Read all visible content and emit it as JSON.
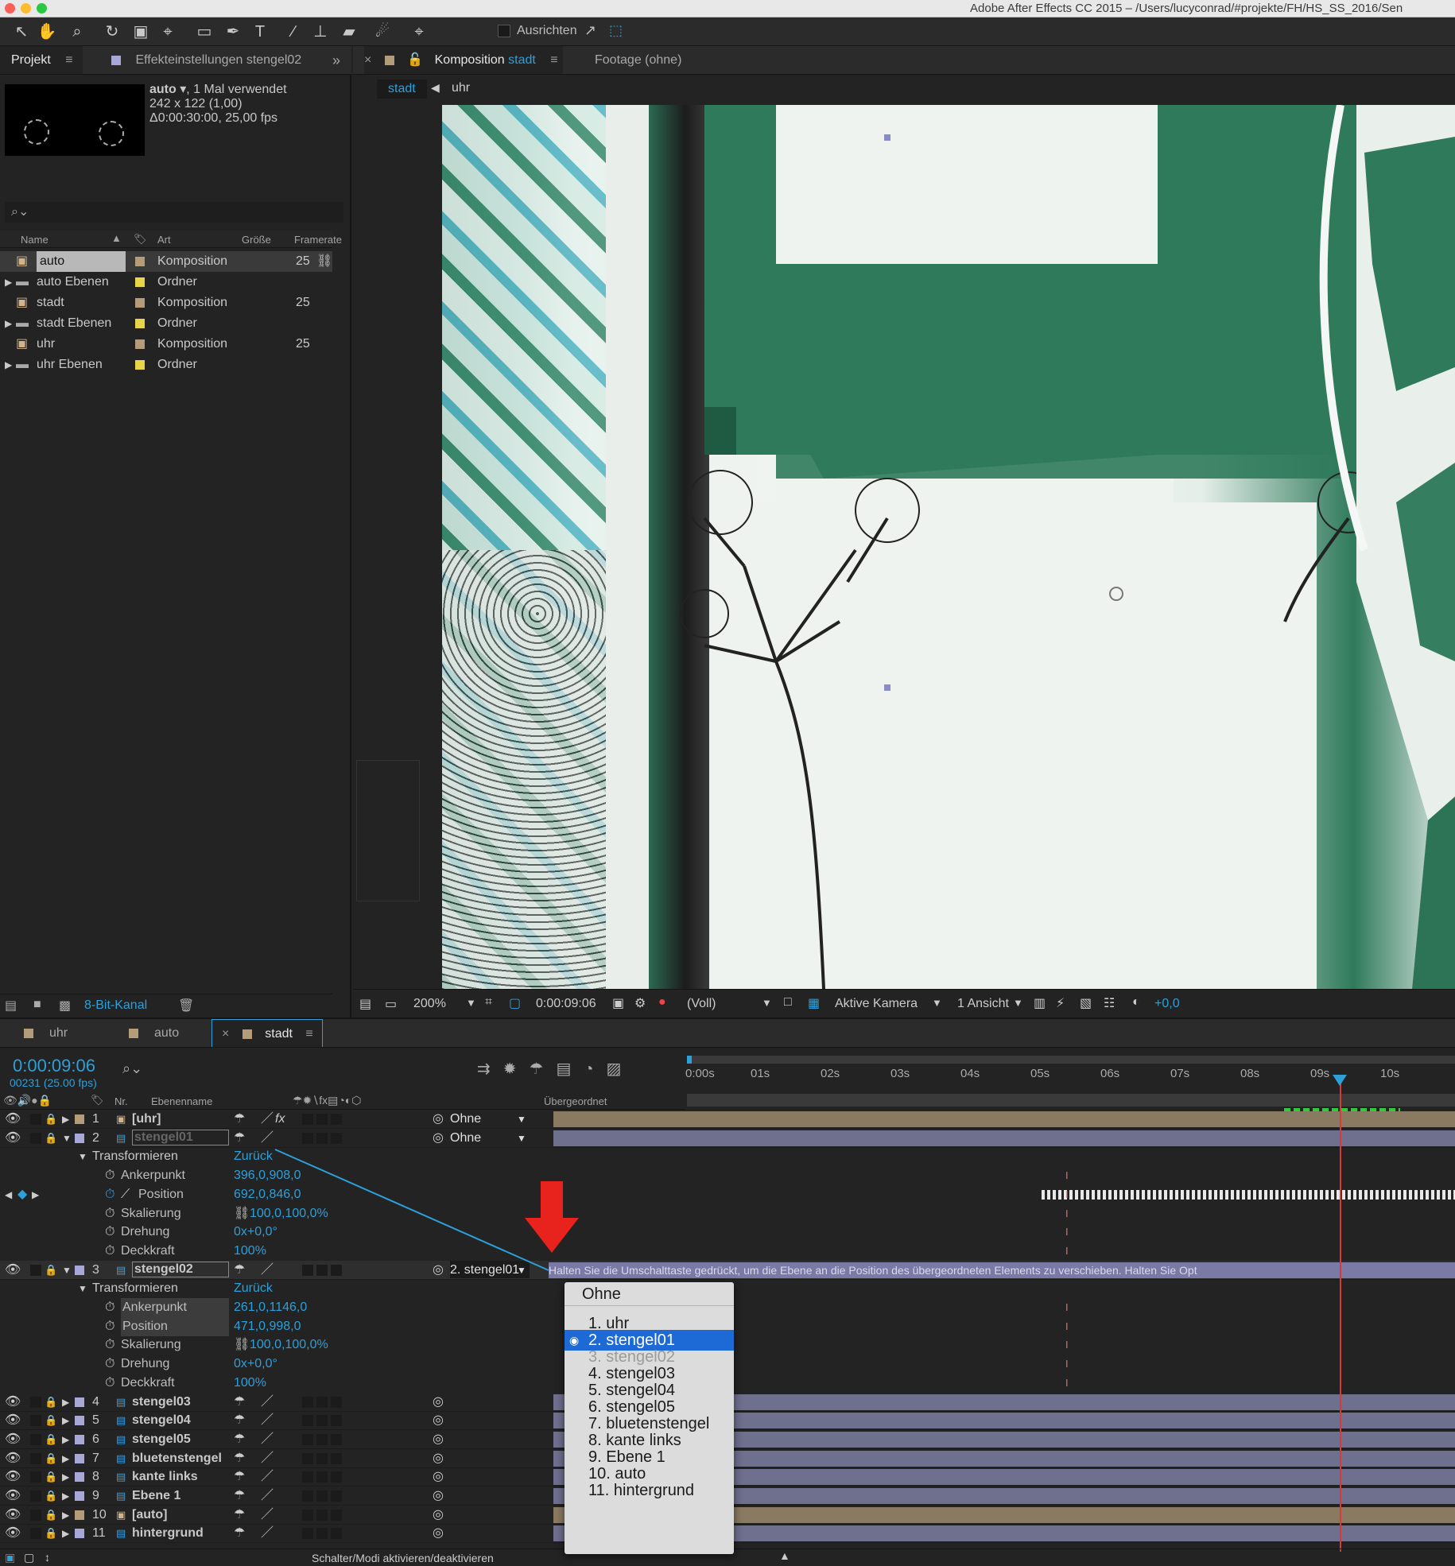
{
  "window": {
    "title": "Adobe After Effects CC 2015 – /Users/lucyconrad/#projekte/FH/HS_SS_2016/Sen"
  },
  "toolbar": {
    "align_label": "Ausrichten",
    "tools": [
      "selection-tool-icon",
      "hand-tool-icon",
      "zoom-tool-icon",
      "rotate-tool-icon",
      "camera-tool-icon",
      "pan-behind-tool-icon",
      "rectangle-tool-icon",
      "pen-tool-icon",
      "text-tool-icon",
      "brush-tool-icon",
      "clone-stamp-tool-icon",
      "eraser-tool-icon",
      "roto-brush-tool-icon",
      "puppet-pin-tool-icon"
    ]
  },
  "project_panel": {
    "tab_project": "Projekt",
    "tab_effects": "Effekteinstellungen stengel02",
    "preview": {
      "name": "auto ▾",
      "usage": ", 1 Mal verwendet",
      "size": "242 x 122 (1,00)",
      "duration": "Δ0:00:30:00, 25,00 fps"
    },
    "search_placeholder": "",
    "columns": [
      "Name",
      "Art",
      "Größe",
      "Framerate"
    ],
    "items": [
      {
        "name": "auto",
        "type": "Komposition",
        "fps": "25",
        "kind": "comp",
        "color": "#b49b7a",
        "selected": true
      },
      {
        "name": "auto Ebenen",
        "type": "Ordner",
        "fps": "",
        "kind": "folder",
        "color": "#e8d44a"
      },
      {
        "name": "stadt",
        "type": "Komposition",
        "fps": "25",
        "kind": "comp",
        "color": "#b49b7a"
      },
      {
        "name": "stadt Ebenen",
        "type": "Ordner",
        "fps": "",
        "kind": "folder",
        "color": "#e8d44a"
      },
      {
        "name": "uhr",
        "type": "Komposition",
        "fps": "25",
        "kind": "comp",
        "color": "#b49b7a"
      },
      {
        "name": "uhr Ebenen",
        "type": "Ordner",
        "fps": "",
        "kind": "folder",
        "color": "#e8d44a"
      }
    ],
    "footer": {
      "bit_depth": "8-Bit-Kanal"
    }
  },
  "composition_panel": {
    "tab_comp_prefix": "Komposition",
    "tab_comp_name": "stadt",
    "tab_footage": "Footage (ohne)",
    "breadcrumb": [
      "stadt",
      "uhr"
    ],
    "footer": {
      "zoom": "200%",
      "timecode": "0:00:09:06",
      "resolution": "(Voll)",
      "camera": "Aktive Kamera",
      "views": "1 Ansicht",
      "exposure": "+0,0"
    }
  },
  "timeline": {
    "tabs": [
      "uhr",
      "auto",
      "stadt"
    ],
    "timecode": "0:00:09:06",
    "frame_info": "00231 (25.00 fps)",
    "ruler": [
      "0:00s",
      "01s",
      "02s",
      "03s",
      "04s",
      "05s",
      "06s",
      "07s",
      "08s",
      "09s",
      "10s"
    ],
    "headers": {
      "nr": "Nr.",
      "layer_name": "Ebenenname",
      "parent": "Übergeordnet"
    },
    "layers": [
      {
        "nr": "1",
        "name": "[uhr]",
        "parent": "Ohne",
        "kind": "comp",
        "color": "#b49b7a",
        "expanded": false
      },
      {
        "nr": "2",
        "name": "stengel01",
        "parent": "Ohne",
        "kind": "ps",
        "color": "#a7a7d8",
        "expanded": true,
        "transform": {
          "label": "Transformieren",
          "reset": "Zurück",
          "props": [
            {
              "name": "Ankerpunkt",
              "value": "396,0,908,0"
            },
            {
              "name": "Position",
              "value": "692,0,846,0"
            },
            {
              "name": "Skalierung",
              "value": "100,0,100,0%"
            },
            {
              "name": "Drehung",
              "value": "0x+0,0°"
            },
            {
              "name": "Deckkraft",
              "value": "100%"
            }
          ]
        }
      },
      {
        "nr": "3",
        "name": "stengel02",
        "parent": "2. stengel01",
        "kind": "ps",
        "color": "#a7a7d8",
        "expanded": true,
        "transform": {
          "label": "Transformieren",
          "reset": "Zurück",
          "props": [
            {
              "name": "Ankerpunkt",
              "value": "261,0,1146,0"
            },
            {
              "name": "Position",
              "value": "471,0,998,0"
            },
            {
              "name": "Skalierung",
              "value": "100,0,100,0%"
            },
            {
              "name": "Drehung",
              "value": "0x+0,0°"
            },
            {
              "name": "Deckkraft",
              "value": "100%"
            }
          ]
        }
      },
      {
        "nr": "4",
        "name": "stengel03",
        "kind": "ps",
        "color": "#a7a7d8"
      },
      {
        "nr": "5",
        "name": "stengel04",
        "kind": "ps",
        "color": "#a7a7d8"
      },
      {
        "nr": "6",
        "name": "stengel05",
        "kind": "ps",
        "color": "#a7a7d8"
      },
      {
        "nr": "7",
        "name": "bluetenstengel",
        "kind": "ps",
        "color": "#a7a7d8"
      },
      {
        "nr": "8",
        "name": "kante links",
        "kind": "ps",
        "color": "#a7a7d8"
      },
      {
        "nr": "9",
        "name": "Ebene 1",
        "kind": "ps",
        "color": "#a7a7d8"
      },
      {
        "nr": "10",
        "name": "[auto]",
        "kind": "comp",
        "color": "#b49b7a"
      },
      {
        "nr": "11",
        "name": "hintergrund",
        "kind": "ps",
        "color": "#a7a7d8"
      }
    ],
    "tooltip": "Halten Sie die Umschalttaste gedrückt, um die Ebene an die Position des übergeordneten Elements zu verschieben. Halten Sie Opt",
    "footer_toggle": "Schalter/Modi aktivieren/deaktivieren"
  },
  "parent_dropdown": {
    "items": [
      {
        "label": "Ohne",
        "state": "normal"
      },
      {
        "label": "1. uhr",
        "state": "normal"
      },
      {
        "label": "2. stengel01",
        "state": "selected"
      },
      {
        "label": "3. stengel02",
        "state": "disabled"
      },
      {
        "label": "4. stengel03",
        "state": "normal"
      },
      {
        "label": "5. stengel04",
        "state": "normal"
      },
      {
        "label": "6. stengel05",
        "state": "normal"
      },
      {
        "label": "7. bluetenstengel",
        "state": "normal"
      },
      {
        "label": "8. kante links",
        "state": "normal"
      },
      {
        "label": "9. Ebene 1",
        "state": "normal"
      },
      {
        "label": "10. auto",
        "state": "normal"
      },
      {
        "label": "11. hintergrund",
        "state": "normal"
      }
    ]
  },
  "colors": {
    "accent": "#2d9fd9",
    "playhead": "#d83a3a",
    "annotation_arrow": "#e8231e",
    "menu_selection": "#1d6ad6"
  }
}
